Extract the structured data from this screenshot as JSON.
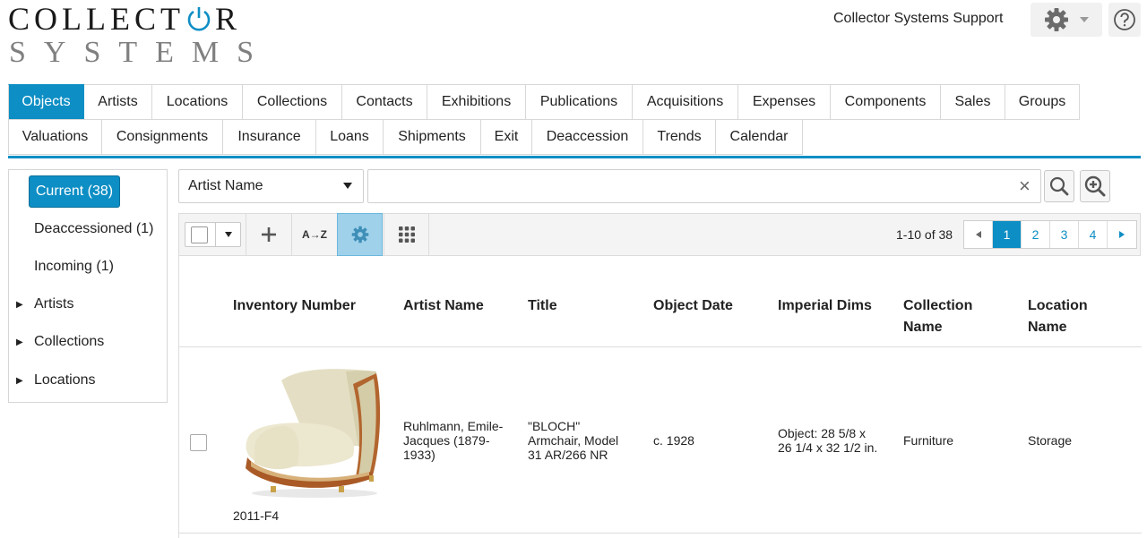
{
  "logo": {
    "line1_pre": "COLLECT",
    "line1_post": "R",
    "line2": "SYSTEMS"
  },
  "header": {
    "support_label": "Collector Systems Support"
  },
  "tabs": {
    "row1": [
      "Objects",
      "Artists",
      "Locations",
      "Collections",
      "Contacts",
      "Exhibitions",
      "Publications",
      "Acquisitions",
      "Expenses",
      "Components",
      "Sales",
      "Groups"
    ],
    "row2": [
      "Valuations",
      "Consignments",
      "Insurance",
      "Loans",
      "Shipments",
      "Exit",
      "Deaccession",
      "Trends",
      "Calendar"
    ],
    "active": "Objects"
  },
  "sidebar": {
    "current": "Current (38)",
    "deaccessioned": "Deaccessioned (1)",
    "incoming": "Incoming (1)",
    "nodes": [
      "Artists",
      "Collections",
      "Locations"
    ]
  },
  "search": {
    "field": "Artist Name",
    "value": "",
    "clear_glyph": "×"
  },
  "toolbar": {
    "sort_label": "A→Z",
    "result_count": "1-10 of 38",
    "pages": [
      "1",
      "2",
      "3",
      "4"
    ],
    "active_page": "1"
  },
  "table": {
    "headers": {
      "inventory": "Inventory Number",
      "artist": "Artist Name",
      "title": "Title",
      "date": "Object Date",
      "dims": "Imperial Dims",
      "collection_1": "Collection",
      "collection_2": "Name",
      "location_1": "Location",
      "location_2": "Name"
    },
    "rows": [
      {
        "inventory": "2011-F4",
        "artist_1": "Ruhlmann, Emile-",
        "artist_2": "Jacques (1879-",
        "artist_3": "1933)",
        "title_1": "\"BLOCH\"",
        "title_2": "Armchair, Model",
        "title_3": "31 AR/266 NR",
        "date": "c. 1928",
        "dims_1": "Object: 28 5/8 x",
        "dims_2": "26 1/4 x 32 1/2 in.",
        "collection": "Furniture",
        "location": "Storage"
      }
    ]
  },
  "colors": {
    "accent": "#0d8ec4",
    "active_tool": "#9fd1ea"
  }
}
